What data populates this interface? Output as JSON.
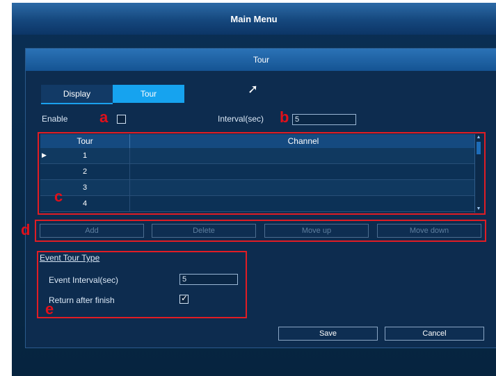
{
  "window": {
    "title": "Main Menu"
  },
  "dialog": {
    "title": "Tour"
  },
  "tabs": [
    {
      "label": "Display",
      "active": false
    },
    {
      "label": "Tour",
      "active": true
    }
  ],
  "enable": {
    "label": "Enable",
    "checked": false
  },
  "interval": {
    "label": "Interval(sec)",
    "value": "5"
  },
  "table": {
    "columns": [
      "Tour",
      "Channel"
    ],
    "rows": [
      {
        "tour": "1",
        "channel": "",
        "selected": true
      },
      {
        "tour": "2",
        "channel": ""
      },
      {
        "tour": "3",
        "channel": ""
      },
      {
        "tour": "4",
        "channel": ""
      }
    ]
  },
  "buttons": {
    "add": "Add",
    "delete": "Delete",
    "move_up": "Move up",
    "move_down": "Move down",
    "save": "Save",
    "cancel": "Cancel"
  },
  "event_tour": {
    "section_title": "Event Tour Type",
    "interval_label": "Event Interval(sec)",
    "interval_value": "5",
    "return_label": "Return after finish",
    "return_checked": true
  },
  "markers": {
    "a": "a",
    "b": "b",
    "c": "c",
    "d": "d",
    "e": "e"
  },
  "colors": {
    "highlight_box": "#e11d24",
    "tab_active": "#16a3ef",
    "title_bar": "#2c6aa6"
  },
  "icons": {
    "cursor": "mouse-pointer-icon",
    "row_pointer": "row-pointer-icon"
  }
}
